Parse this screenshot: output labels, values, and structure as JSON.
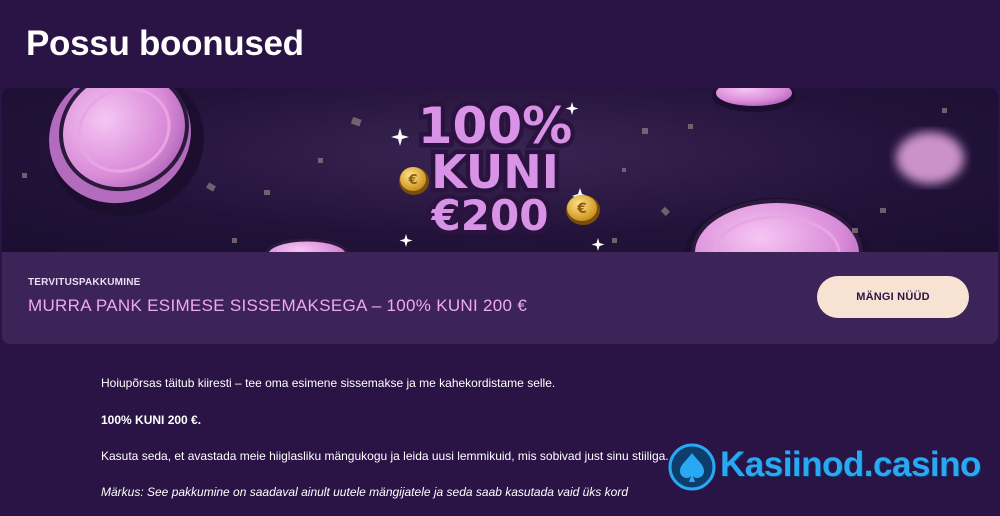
{
  "header": {
    "title": "Possu boonused"
  },
  "promo": {
    "banner_text": [
      "100%",
      "KUNI",
      "€200"
    ],
    "tag": "TERVITUSPAKKUMINE",
    "offer": "MURRA PANK ESIMESE SISSEMAKSEGA – 100% KUNI 200 €",
    "play_button": "MÄNGI NÜÜD"
  },
  "description": {
    "line1": "Hoiupõrsas täitub kiiresti – tee oma esimene sissemakse ja me kahekordistame selle.",
    "line2": "100% KUNI 200 €.",
    "line3": "Kasuta seda, et avastada meie hiiglasliku mängukogu ja leida uusi lemmikuid, mis sobivad just sinu stiiliga.",
    "note": "Märkus: See pakkumine on saadaval ainult uutele mängijatele ja seda saab kasutada vaid üks kord"
  },
  "watermark": {
    "text": "Kasiinod.casino",
    "icon": "spade-icon"
  },
  "colors": {
    "background": "#2a1446",
    "card": "#3c2459",
    "offer_text": "#f0a9f0",
    "button": "#f7e2d4",
    "logo": "#29a8f4"
  }
}
